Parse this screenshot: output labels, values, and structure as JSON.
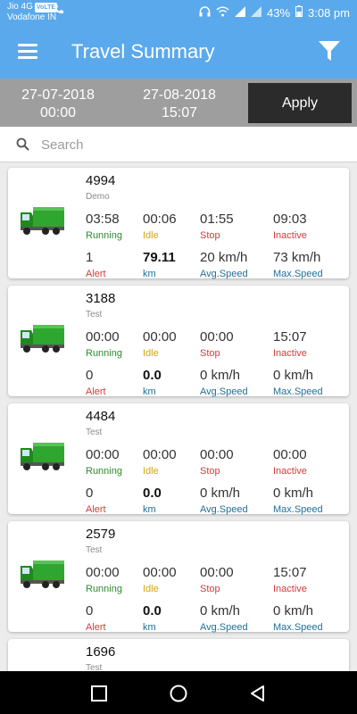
{
  "status_bar": {
    "carrier_line1": "Jio 4G",
    "volte": "VoLTE",
    "carrier_line2": "Vodafone IN",
    "battery": "43%",
    "time": "3:08 pm"
  },
  "app_bar": {
    "title": "Travel Summary"
  },
  "date_range": {
    "from_date": "27-07-2018",
    "from_time": "00:00",
    "to_date": "27-08-2018",
    "to_time": "15:07",
    "apply_label": "Apply"
  },
  "search": {
    "placeholder": "Search"
  },
  "labels": {
    "running": "Running",
    "idle": "Idle",
    "stop": "Stop",
    "inactive": "Inactive",
    "alert": "Alert",
    "km": "km",
    "avg_speed": "Avg.Speed",
    "max_speed": "Max.Speed"
  },
  "vehicles": [
    {
      "id": "4994",
      "group": "Demo",
      "running": "03:58",
      "idle": "00:06",
      "stop": "01:55",
      "inactive": "09:03",
      "alert": "1",
      "km": "79.11",
      "avg_speed": "20 km/h",
      "max_speed": "73 km/h"
    },
    {
      "id": "3188",
      "group": "Test",
      "running": "00:00",
      "idle": "00:00",
      "stop": "00:00",
      "inactive": "15:07",
      "alert": "0",
      "km": "0.0",
      "avg_speed": "0 km/h",
      "max_speed": "0 km/h"
    },
    {
      "id": "4484",
      "group": "Test",
      "running": "00:00",
      "idle": "00:00",
      "stop": "00:00",
      "inactive": "00:00",
      "alert": "0",
      "km": "0.0",
      "avg_speed": "0 km/h",
      "max_speed": "0 km/h"
    },
    {
      "id": "2579",
      "group": "Test",
      "running": "00:00",
      "idle": "00:00",
      "stop": "00:00",
      "inactive": "15:07",
      "alert": "0",
      "km": "0.0",
      "avg_speed": "0 km/h",
      "max_speed": "0 km/h"
    },
    {
      "id": "1696",
      "group": "Test"
    }
  ],
  "icons": {
    "menu": "hamburger-menu-icon",
    "filter": "filter-funnel-icon",
    "search": "search-icon",
    "vehicle": "truck-icon",
    "nav_recents": "square-icon",
    "nav_home": "circle-icon",
    "nav_back": "triangle-back-icon"
  },
  "colors": {
    "primary": "#5aa9ec",
    "date_bar": "#9e9e9e",
    "apply_button": "#2b2b2b",
    "running": "#2e8b2e",
    "idle": "#d4a800",
    "stop": "#d23b3b",
    "info": "#1f6f96"
  }
}
